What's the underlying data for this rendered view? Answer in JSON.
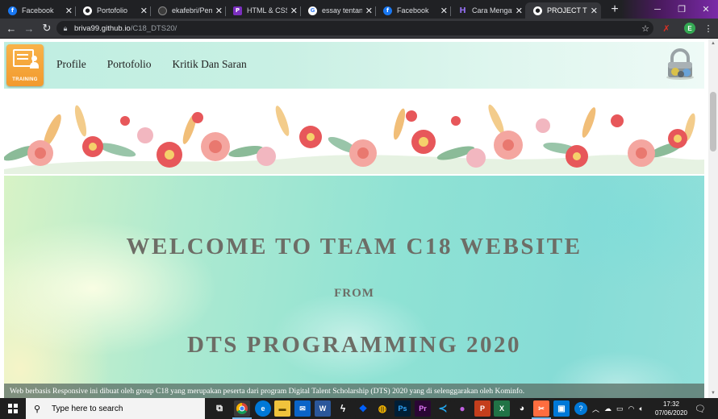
{
  "browser": {
    "tabs": [
      {
        "title": "Facebook",
        "favicon": "facebook-icon",
        "active": false
      },
      {
        "title": "Portofolio",
        "favicon": "github-icon",
        "active": false
      },
      {
        "title": "ekafebri/Pemr",
        "favicon": "github-icon",
        "active": false
      },
      {
        "title": "HTML & CSS S",
        "favicon": "purple-p-icon",
        "active": false
      },
      {
        "title": "essay tentang",
        "favicon": "google-icon",
        "active": false
      },
      {
        "title": "Facebook",
        "favicon": "facebook-icon",
        "active": false
      },
      {
        "title": "Cara Mengata",
        "favicon": "hashnode-icon",
        "active": false
      },
      {
        "title": "PROJECT TEAM",
        "favicon": "github-icon",
        "active": true
      }
    ],
    "url_host": "briva99.github.io",
    "url_path": "/C18_DTS20/",
    "profile_initial": "E"
  },
  "site": {
    "logo_text": "TRAINING",
    "nav": [
      {
        "label": "Profile"
      },
      {
        "label": "Portofolio"
      },
      {
        "label": "Kritik Dan Saran"
      }
    ],
    "hero_title": "WELCOME TO TEAM C18 WEBSITE",
    "hero_from": "FROM",
    "hero_subtitle": "DTS PROGRAMMING 2020",
    "hero_footer": "Web berbasis Responsive ini dibuat oleh group C18 yang merupakan peserta dari program Digital Talent Scholarship (DTS) 2020 yang di selenggarakan oleh Kominfo."
  },
  "taskbar": {
    "search_placeholder": "Type here to search",
    "time": "17:32",
    "date": "07/06/2020",
    "apps": [
      "task-view",
      "chrome",
      "edge",
      "file-explorer",
      "mail",
      "word",
      "sway",
      "dropbox",
      "chrome-2",
      "photoshop",
      "premiere",
      "vscode",
      "color-drop",
      "powerpoint",
      "excel",
      "game",
      "snip-sketch",
      "photos"
    ]
  },
  "colors": {
    "navbar_bg": "#c9f0e4",
    "logo_orange": "#f29a2e",
    "hero_text": "#6d6d66",
    "chrome_dark": "#202124"
  }
}
